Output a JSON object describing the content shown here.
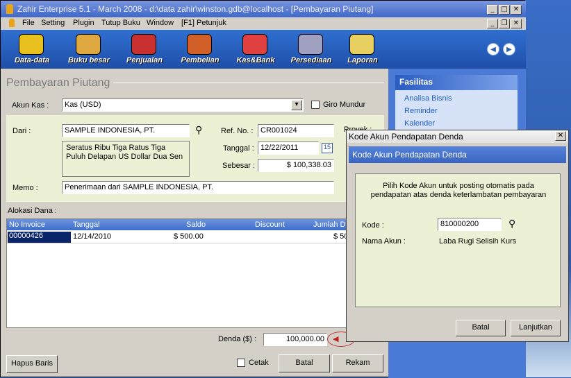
{
  "window": {
    "title": "Zahir Enterprise 5.1 - March 2008 - d:\\data zahir\\winston.gdb@localhost - [Pembayaran Piutang]"
  },
  "menu": [
    "File",
    "Setting",
    "Plugin",
    "Tutup Buku",
    "Window",
    "[F1] Petunjuk"
  ],
  "toolbar": [
    {
      "label": "Data-data",
      "icon": "data-folder-icon",
      "color": "#e8c020"
    },
    {
      "label": "Buku besar",
      "icon": "ledger-book-icon",
      "color": "#e0a840"
    },
    {
      "label": "Penjualan",
      "icon": "sales-car-icon",
      "color": "#c83030"
    },
    {
      "label": "Pembelian",
      "icon": "purchase-basket-icon",
      "color": "#d06028"
    },
    {
      "label": "Kas&Bank",
      "icon": "cash-bank-icon",
      "color": "#e04040"
    },
    {
      "label": "Persediaan",
      "icon": "inventory-icon",
      "color": "#a0a0c0"
    },
    {
      "label": "Laporan",
      "icon": "report-scroll-icon",
      "color": "#e8d060"
    }
  ],
  "form": {
    "title": "Pembayaran Piutang",
    "akun_kas_label": "Akun Kas :",
    "akun_kas_value": "Kas (USD)",
    "giro_label": "Giro Mundur",
    "dari_label": "Dari :",
    "dari_value": "SAMPLE  INDONESIA, PT.",
    "terbilang": "Seratus Ribu Tiga Ratus Tiga Puluh Delapan US Dollar Dua Sen",
    "ref_label": "Ref. No. :",
    "ref_value": "CR001024",
    "tanggal_label": "Tanggal :",
    "tanggal_value": "12/22/2011",
    "calendar_day": "15",
    "sebesar_label": "Sebesar :",
    "sebesar_value": "$ 100,338.03",
    "proyek_label": "Proyek :",
    "memo_label": "Memo :",
    "memo_value": "Penerimaan dari SAMPLE  INDONESIA, PT.",
    "alokasi_label": "Alokasi Dana :",
    "denda_label": "Denda ($) :",
    "denda_value": "100,000.00"
  },
  "grid": {
    "headers": [
      "No Invoice",
      "Tanggal",
      "Saldo",
      "Discount",
      "Jumlah Dib"
    ],
    "rows": [
      [
        "00000426",
        "12/14/2010",
        "$ 500.00",
        "",
        "$ 50"
      ]
    ]
  },
  "buttons": {
    "hapus": "Hapus Baris",
    "cetak": "Cetak",
    "batal": "Batal",
    "rekam": "Rekam"
  },
  "side": {
    "title": "Fasilitas",
    "items": [
      "Analisa Bisnis",
      "Reminder",
      "Kalender"
    ]
  },
  "dialog": {
    "title": "Kode Akun Pendapatan Denda",
    "header": "Kode Akun Pendapatan Denda",
    "description": "Pilih Kode Akun untuk posting otomatis pada pendapatan atas denda keterlambatan pembayaran",
    "kode_label": "Kode :",
    "kode_value": "810000200",
    "nama_label": "Nama Akun :",
    "nama_value": "Laba Rugi Selisih Kurs",
    "batal": "Batal",
    "lanjutkan": "Lanjutkan"
  }
}
